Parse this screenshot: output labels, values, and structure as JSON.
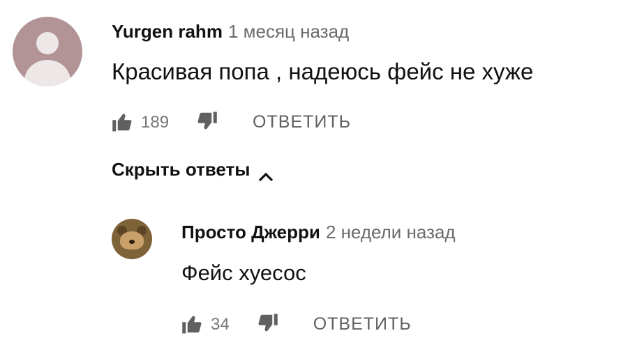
{
  "comment": {
    "author": "Yurgen rahm",
    "timestamp": "1 месяц назад",
    "text": "Красивая попа , надеюсь фейс не хуже",
    "like_count": "189",
    "reply_label": "ОТВЕТИТЬ",
    "avatar_icon": "default-user-avatar",
    "avatar_color": "#b39496"
  },
  "replies_toggle": {
    "label": "Скрыть ответы",
    "icon": "chevron-up-icon"
  },
  "reply": {
    "author": "Просто Джерри",
    "timestamp": "2 недели назад",
    "text": "Фейс хуесос",
    "like_count": "34",
    "reply_label": "ОТВЕТИТЬ",
    "avatar_icon": "jerry-mouse-avatar"
  },
  "icons": {
    "like": "thumbs-up-icon",
    "dislike": "thumbs-down-icon"
  },
  "colors": {
    "text_primary": "#111111",
    "text_secondary": "#6a6a6a",
    "icon": "#606060"
  }
}
